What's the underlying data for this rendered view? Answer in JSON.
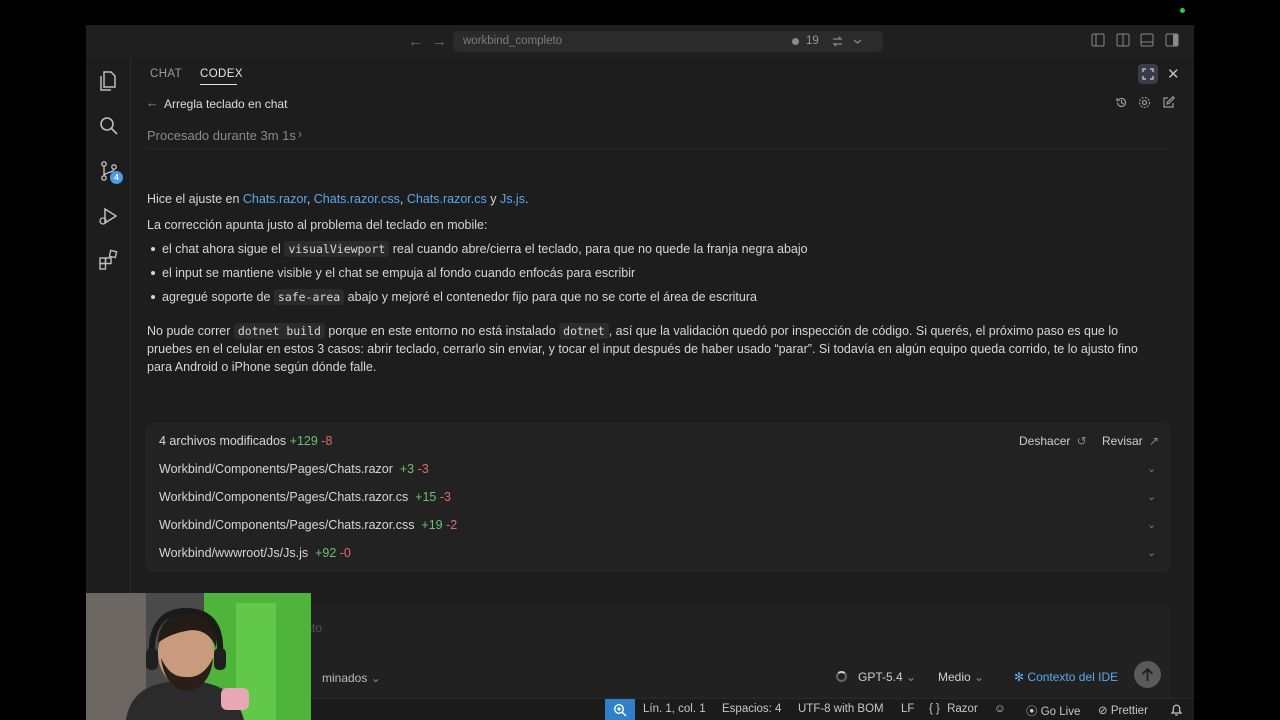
{
  "titlebar": {
    "search_text": "workbind_completo",
    "notification_count": "19"
  },
  "activity": {
    "scm_badge": "4"
  },
  "panel": {
    "tabs": [
      "CHAT",
      "CODEX"
    ],
    "active_tab": "CODEX",
    "thread_title": "Arregla teclado en chat",
    "processed_label": "Procesado durante 3m 1s"
  },
  "message": {
    "intro_prefix": "Hice el ajuste en ",
    "files": [
      "Chats.razor",
      "Chats.razor.css",
      "Chats.razor.cs",
      "Js.js"
    ],
    "sep_comma": ", ",
    "sep_and": " y ",
    "period": ".",
    "summary": "La corrección apunta justo al problema del teclado en mobile:",
    "bullet1_a": "el chat ahora sigue el ",
    "bullet1_code": "visualViewport",
    "bullet1_b": " real cuando abre/cierra el teclado, para que no quede la franja negra abajo",
    "bullet2": "el input se mantiene visible y el chat se empuja al fondo cuando enfocás para escribir",
    "bullet3_a": "agregué soporte de ",
    "bullet3_code": "safe-area",
    "bullet3_b": " abajo y mejoré el contenedor fijo para que no se corte el área de escritura",
    "para_a": "No pude correr ",
    "para_code1": "dotnet build",
    "para_b": " porque en este entorno no está instalado ",
    "para_code2": "dotnet",
    "para_c": ", así que la validación quedó por inspección de código. Si querés, el próximo paso es que lo",
    "para_line2": "pruebes en el celular en estos 3 casos: abrir teclado, cerrarlo sin enviar, y tocar el input después de haber usado “parar”. Si todavía en algún equipo queda corrido, te lo ajusto fino",
    "para_line3": "para Android o iPhone según dónde falle."
  },
  "changes": {
    "summary": "4 archivos modificados",
    "added": "+129",
    "removed": "-8",
    "undo_label": "Deshacer",
    "review_label": "Revisar",
    "files": [
      {
        "path": "Workbind/Components/Pages/Chats.razor",
        "added": "+3",
        "removed": "-3"
      },
      {
        "path": "Workbind/Components/Pages/Chats.razor.cs",
        "added": "+15",
        "removed": "-3"
      },
      {
        "path": "Workbind/Components/Pages/Chats.razor.css",
        "added": "+19",
        "removed": "-2"
      },
      {
        "path": "Workbind/wwwroot/Js/Js.js",
        "added": "+92",
        "removed": "-0"
      }
    ]
  },
  "composer": {
    "placeholder_fragment": "iento",
    "permissions_fragment": "minados",
    "model": "GPT-5.4",
    "effort": "Medio",
    "context_label": "Contexto del IDE"
  },
  "statusbar": {
    "position": "Lín. 1, col. 1",
    "spaces": "Espacios: 4",
    "encoding": "UTF-8 with BOM",
    "eol": "LF",
    "language": "Razor",
    "golive": "Go Live",
    "prettier": "Prettier"
  },
  "colors": {
    "accent_blue": "#5aa9ec",
    "added_green": "#6cc070",
    "removed_red": "#e06c6c",
    "status_blue": "#2f80c6"
  },
  "icons": [
    "files-icon",
    "search-icon",
    "source-control-icon",
    "run-debug-icon",
    "extensions-icon",
    "history-icon",
    "settings-icon",
    "new-thread-icon",
    "undo-icon",
    "external-link-icon",
    "sparkle-icon",
    "arrow-up-icon",
    "bell-icon"
  ]
}
